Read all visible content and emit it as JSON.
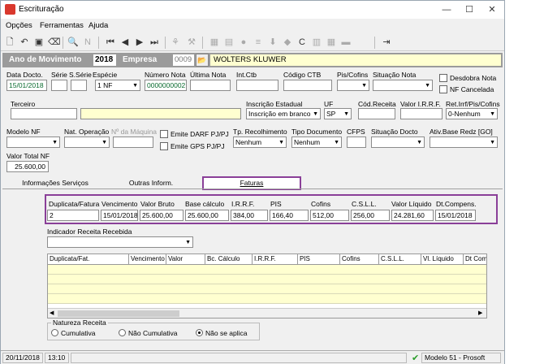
{
  "window": {
    "title": "Escrituração",
    "min": "—",
    "max": "☐",
    "close": "✕"
  },
  "menu": {
    "opcoes": "Opções",
    "ferramentas": "Ferramentas",
    "ajuda": "Ajuda"
  },
  "header": {
    "ano_label": "Ano de Movimento",
    "ano_value": "2018",
    "empresa_label": "Empresa",
    "empresa_code": "0009",
    "empresa_name": "WOLTERS KLUWER"
  },
  "form": {
    "data_docto_label": "Data Docto.",
    "data_docto": "15/01/2018",
    "serie_label": "Série",
    "sserie_label": "S.Série",
    "especie_label": "Espécie",
    "especie": "1 NF",
    "numero_nota_label": "Número Nota",
    "numero_nota": "0000000002",
    "ultima_nota_label": "Última Nota",
    "int_ctb_label": "Int.Ctb",
    "codigo_ctb_label": "Código CTB",
    "pis_cofins_label": "Pis/Cofins",
    "situacao_nota_label": "Situação Nota",
    "desdobra_nota_label": "Desdobra Nota",
    "nf_cancelada_label": "NF Cancelada",
    "terceiro_label": "Terceiro",
    "inscricao_estadual_label": "Inscrição Estadual",
    "inscricao_estadual": "Inscrição em branco",
    "uf_label": "UF",
    "uf": "SP",
    "cod_receita_label": "Cód.Receita",
    "valor_irrf_label": "Valor I.R.R.F.",
    "ret_irrf_label": "Ret.Irrf/Pis/Cofins",
    "ret_irrf": "0-Nenhum",
    "modelo_nf_label": "Modelo NF",
    "nat_operacao_label": "Nat. Operação",
    "n_maquina_label": "Nº da Máquina",
    "emite_darf_label": "Emite DARF PJ/PJ",
    "emite_gps_label": "Emite GPS PJ/PJ",
    "tp_recolhimento_label": "Tp. Recolhimento",
    "tp_recolhimento": "Nenhum",
    "tipo_documento_label": "Tipo Documento",
    "tipo_documento": "Nenhum",
    "cfps_label": "CFPS",
    "situacao_docto_label": "Situação Docto",
    "ativ_base_label": "Ativ.Base Redz [GO]",
    "valor_total_label": "Valor Total NF",
    "valor_total": "25.600,00"
  },
  "tabs": {
    "info_servicos": "Informações Serviços",
    "outras_inform": "Outras Inform.",
    "faturas": "Faturas"
  },
  "faturas": {
    "headers": {
      "duplicata": "Duplicata/Fatura",
      "vencimento": "Vencimento",
      "valor_bruto": "Valor Bruto",
      "base_calculo": "Base cálculo",
      "irrf": "I.R.R.F.",
      "pis": "PIS",
      "cofins": "Cofins",
      "csll": "C.S.L.L.",
      "valor_liquido": "Valor Líquido",
      "dt_compens": "Dt.Compens."
    },
    "values": {
      "duplicata": "2",
      "vencimento": "15/01/2018",
      "valor_bruto": "25.600,00",
      "base_calculo": "25.600,00",
      "irrf": "384,00",
      "pis": "166,40",
      "cofins": "512,00",
      "csll": "256,00",
      "valor_liquido": "24.281,60",
      "dt_compens": "15/01/2018"
    },
    "indicador_label": "Indicador Receita Recebida"
  },
  "grid": {
    "columns": [
      "Duplicata/Fat.",
      "Vencimento",
      "Valor",
      "Bc. Cálculo",
      "I.R.R.F.",
      "PIS",
      "Cofins",
      "C.S.L.L.",
      "Vl. Líquido",
      "Dt Com"
    ]
  },
  "natureza": {
    "label": "Natureza Receita",
    "cumulativa": "Cumulativa",
    "nao_cumulativa": "Não Cumulativa",
    "nao_se_aplica": "Não se aplica"
  },
  "status": {
    "date": "20/11/2018",
    "time": "13:10",
    "model": "Modelo 51 - Prosoft"
  }
}
